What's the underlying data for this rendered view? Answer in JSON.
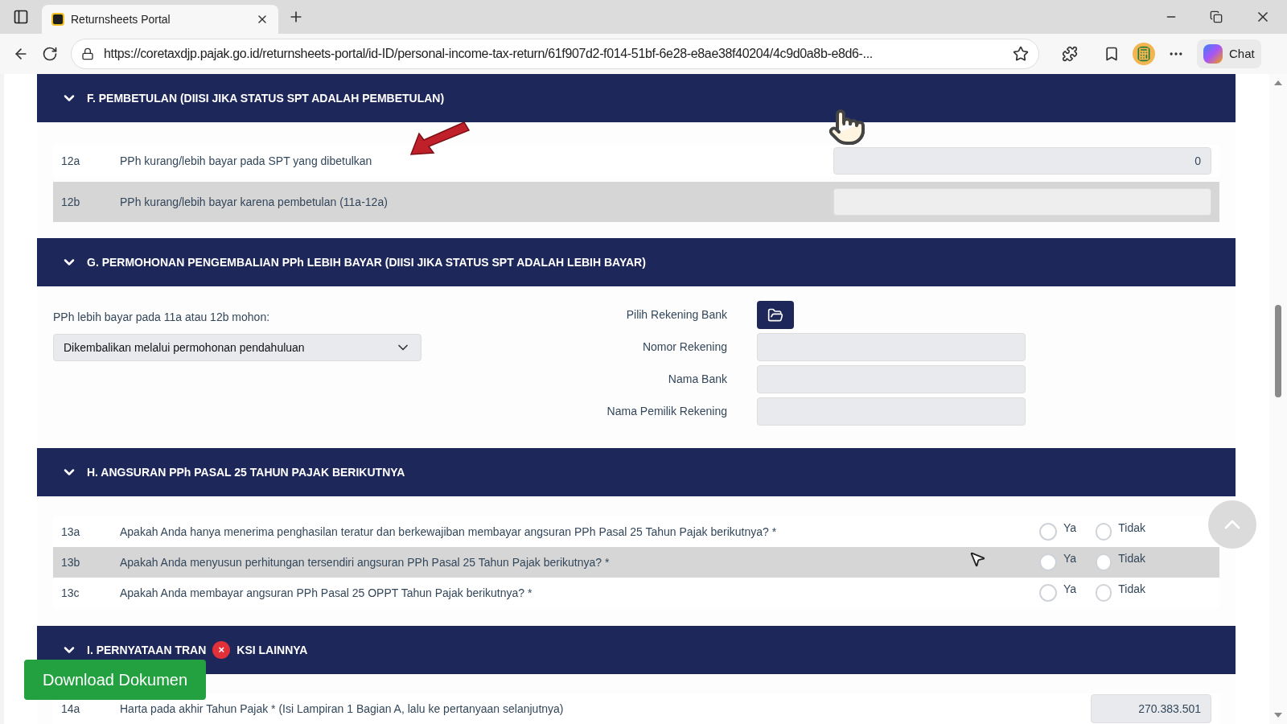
{
  "browser": {
    "tab_title": "Returnsheets Portal",
    "url": "https://coretaxdjp.pajak.go.id/returnsheets-portal/id-ID/personal-income-tax-return/61f907d2-f014-51bf-6e28-e8ae38f40204/4c9d0a8b-e8d6-...",
    "chat_label": "Chat"
  },
  "section_f": {
    "title": "F. PEMBETULAN (DIISI JIKA STATUS SPT ADALAH PEMBETULAN)",
    "expanded": true,
    "rows": [
      {
        "number": "12a",
        "label": "PPh kurang/lebih bayar pada SPT yang dibetulkan",
        "value": "0",
        "shaded": false
      },
      {
        "number": "12b",
        "label": "PPh kurang/lebih bayar karena pembetulan (11a-12a)",
        "shaded": true
      }
    ]
  },
  "section_g": {
    "title": "G. PERMOHONAN PENGEMBALIAN PPh LEBIH BAYAR (DIISI JIKA STATUS SPT ADALAH LEBIH BAYAR)",
    "expanded": true,
    "refund_label": "PPh lebih bayar pada 11a atau 12b mohon:",
    "refund_select": "Dikembalikan melalui permohonan pendahuluan",
    "bank_picker_label": "Pilih Rekening Bank",
    "fields": [
      {
        "label": "Nomor Rekening"
      },
      {
        "label": "Nama Bank"
      },
      {
        "label": "Nama Pemilik Rekening"
      }
    ]
  },
  "section_h": {
    "title": "H. ANGSURAN PPh PASAL 25 TAHUN PAJAK BERIKUTNYA",
    "expanded": true,
    "rows": [
      {
        "number": "13a",
        "label": "Apakah Anda hanya menerima penghasilan teratur dan berkewajiban membayar angsuran PPh Pasal 25 Tahun Pajak berikutnya? *",
        "shaded": false,
        "options": [
          {
            "label": "Ya",
            "selected": false
          },
          {
            "label": "Tidak",
            "selected": false
          }
        ]
      },
      {
        "number": "13b",
        "label": "Apakah Anda menyusun perhitungan tersendiri angsuran PPh Pasal 25 Tahun Pajak berikutnya? *",
        "shaded": true,
        "options": [
          {
            "label": "Ya",
            "selected": false
          },
          {
            "label": "Tidak",
            "selected": false
          }
        ]
      },
      {
        "number": "13c",
        "label": "Apakah Anda membayar angsuran PPh Pasal 25 OPPT Tahun Pajak berikutnya? *",
        "shaded": false,
        "options": [
          {
            "label": "Ya",
            "selected": false
          },
          {
            "label": "Tidak",
            "selected": false
          }
        ]
      }
    ]
  },
  "section_i": {
    "title_parts": [
      "I. PERNYATAAN TRAN",
      "KSI LAINNYA"
    ],
    "expanded": true,
    "rows": [
      {
        "number": "14a",
        "label": "Harta pada akhir Tahun Pajak * (Isi Lampiran 1 Bagian A, lalu ke pertanyaan selanjutnya)",
        "value": "270.383.501"
      }
    ]
  },
  "download": {
    "label": "Download Dokumen",
    "close": "×"
  }
}
